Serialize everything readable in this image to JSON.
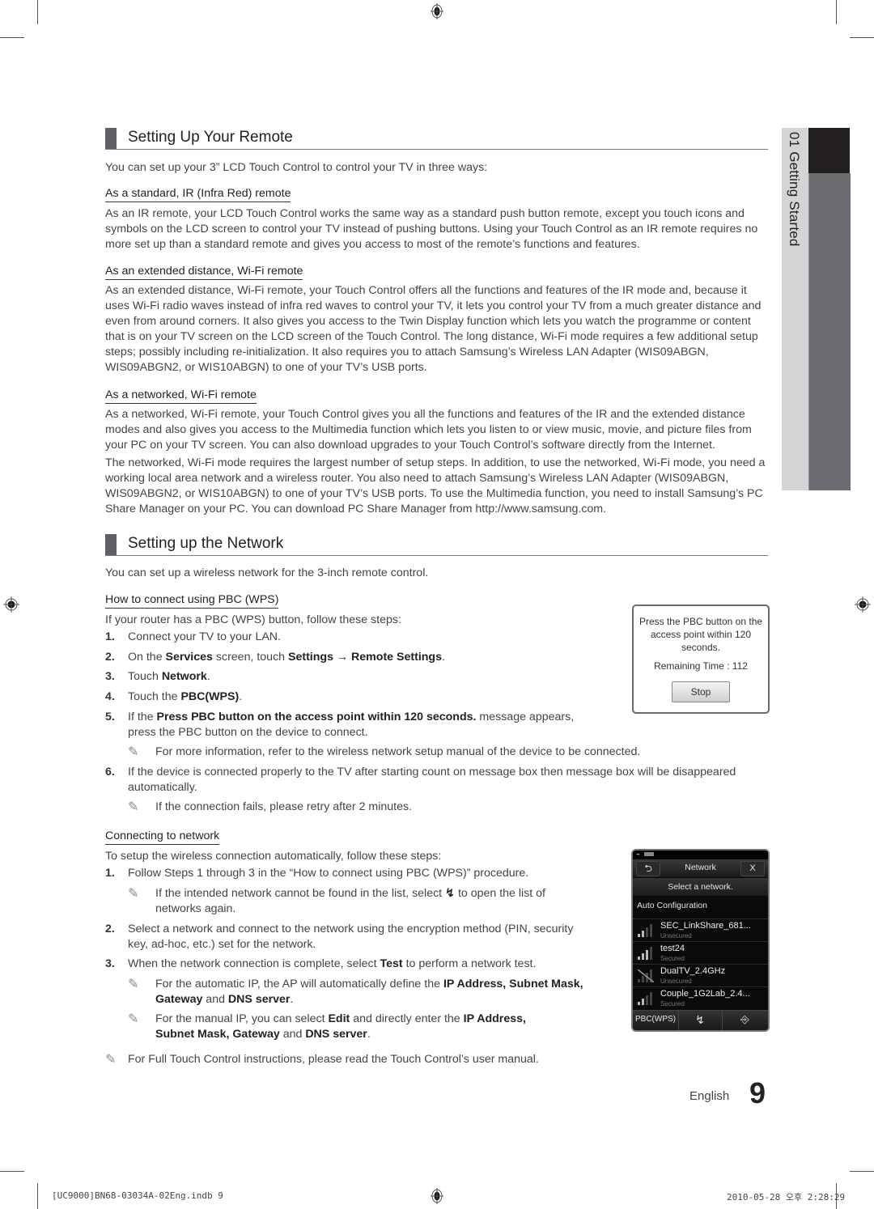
{
  "side_tab": {
    "label": "01  Getting Started"
  },
  "section1": {
    "title": "Setting Up Your Remote",
    "intro": "You can set up your 3” LCD Touch Control to control your TV in three ways:",
    "subsections": [
      {
        "heading": "As a standard, IR (Infra Red) remote",
        "paragraphs": [
          "As an IR remote, your LCD Touch Control works the same way as a standard push button remote, except you touch icons and symbols on the LCD screen to control your TV instead of pushing buttons. Using your Touch Control as an IR remote requires no more set up than a standard remote and gives you access to most of the remote’s functions and features."
        ]
      },
      {
        "heading": "As an extended distance, Wi-Fi remote",
        "paragraphs": [
          "As an extended distance, Wi-Fi remote, your Touch Control offers all the functions and features of the IR mode and, because it uses Wi-Fi radio waves instead of infra red waves to control your TV, it lets you control your TV from a much greater distance and even from around corners. It also gives you access to the Twin Display function which lets you watch the programme or content that is on your TV screen on the LCD screen of the Touch Control. The long distance, Wi-Fi mode requires a few additional setup steps; possibly including re-initialization. It also requires you to attach Samsung’s Wireless LAN Adapter (WIS09ABGN, WIS09ABGN2, or WIS10ABGN) to one of your TV’s USB ports."
        ]
      },
      {
        "heading": "As a networked, Wi-Fi remote",
        "paragraphs": [
          "As a networked, Wi-Fi remote, your Touch Control gives you all the functions and features of the IR and the extended distance modes and also gives you access to the Multimedia function which lets you listen to or view music, movie, and picture files from your PC on your TV screen. You can also download upgrades to your Touch Control’s software directly from the Internet.",
          "The networked, Wi-Fi mode requires the largest number of setup steps. In addition, to use the networked, Wi-Fi mode, you need a working local area network and a wireless router. You also need to attach Samsung’s Wireless LAN Adapter (WIS09ABGN, WIS09ABGN2, or WIS10ABGN) to one of your TV’s USB ports. To use the Multimedia function, you need to install Samsung’s PC Share Manager on your PC. You can download PC Share Manager from http://www.samsung.com."
        ]
      }
    ]
  },
  "section2": {
    "title": "Setting up the Network",
    "intro": "You can set up a wireless network for the 3-inch remote control.",
    "pbc": {
      "heading": "How to connect using PBC (WPS)",
      "lead": "If your router has a PBC (WPS) button, follow these steps:",
      "steps": [
        {
          "num": "1.",
          "parts": [
            "Connect your TV to your LAN."
          ]
        },
        {
          "num": "2.",
          "pre": "On the ",
          "b1": "Services",
          "mid1": " screen, touch ",
          "b2": "Settings → Remote Settings",
          "post": "."
        },
        {
          "num": "3.",
          "pre": "Touch ",
          "b1": "Network",
          "post": "."
        },
        {
          "num": "4.",
          "pre": "Touch the ",
          "b1": "PBC(WPS)",
          "post": "."
        },
        {
          "num": "5.",
          "pre": "If the ",
          "b1": "Press PBC button on the access point within 120 seconds.",
          "post": " message appears,",
          "line2": "press the PBC button on the device to connect."
        },
        {
          "num": "6.",
          "line1": "If the device is connected properly to the TV after starting count on message box then message box will be disappeared",
          "line2": "automatically."
        }
      ],
      "note5": "For more information, refer to the wireless network setup manual of the device to be connected.",
      "note6": "If the connection fails, please retry after 2 minutes."
    },
    "dialog": {
      "message": "Press the PBC button on the access point within 120 seconds.",
      "remaining_label": "Remaining Time : 112",
      "remaining_seconds": 112,
      "stop_button": "Stop"
    },
    "connect": {
      "heading": "Connecting to network",
      "lead": "To setup the wireless connection automatically, follow these steps:",
      "step1": "Follow Steps 1 through 3 in the “How to connect using PBC (WPS)” procedure.",
      "note1_pre": "If the intended network cannot be found in the list, select",
      "note1_post": "to open the list of",
      "note1_line2": "networks again.",
      "step2_line1": "Select a network and connect to the network using the encryption method (PIN, security",
      "step2_line2": "key, ad-hoc, etc.) set for the network.",
      "step3_pre": "When the network connection is complete, select ",
      "step3_b": "Test",
      "step3_post": " to perform a network test.",
      "note3a_pre": "For the automatic IP, the AP will automatically define the ",
      "note3a_b": "IP Address, Subnet Mask,",
      "note3a_l2_b1": "Gateway",
      "note3a_l2_mid": " and ",
      "note3a_l2_b2": "DNS server",
      "note3a_l2_post": ".",
      "note3b_pre": "For the manual IP, you can select ",
      "note3b_b1": "Edit",
      "note3b_mid": " and directly enter the ",
      "note3b_b2": "IP Address,",
      "note3b_l2_b1": "Subnet Mask, Gateway",
      "note3b_l2_mid": " and ",
      "note3b_l2_b2": "DNS server",
      "note3b_l2_post": ".",
      "final_note": "For Full Touch Control instructions, please read the Touch Control’s user manual."
    },
    "network_screen": {
      "title": "Network",
      "back_icon": "⮌",
      "close_label": "X",
      "subtitle": "Select a network.",
      "auto_config": "Auto Configuration",
      "networks": [
        {
          "name": "SEC_LinkShare_681...",
          "security": "Unsecured",
          "signal": "weak"
        },
        {
          "name": "test24",
          "security": "Secured",
          "signal": "medium"
        },
        {
          "name": "DualTV_2.4GHz",
          "security": "Unsecured",
          "signal": "none"
        },
        {
          "name": "Couple_1G2Lab_2.4...",
          "security": "Secured",
          "signal": "weak"
        }
      ],
      "footer": {
        "pbc_label": "PBC(WPS)"
      }
    }
  },
  "footer": {
    "language": "English",
    "page_number": "9",
    "slug_left": "[UC9000]BN68-03034A-02Eng.indb   9",
    "slug_right": "2010-05-28   오후 2:28:29"
  }
}
